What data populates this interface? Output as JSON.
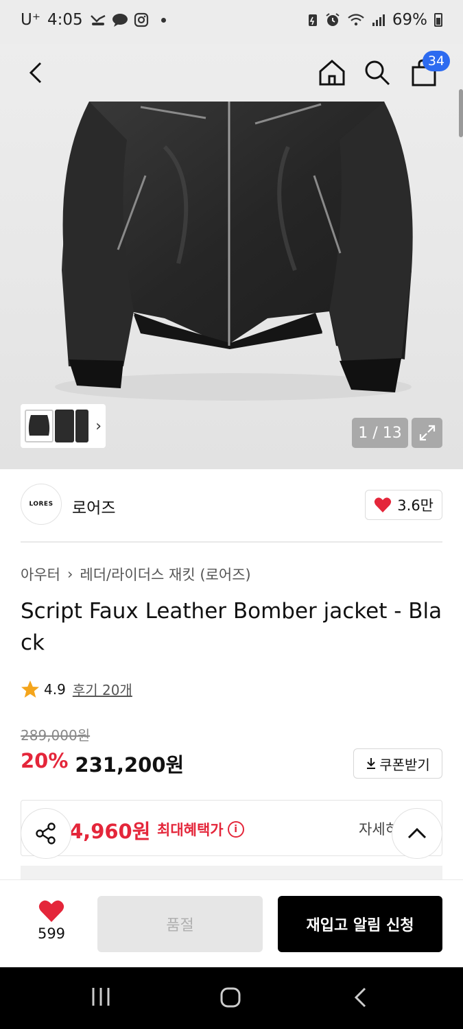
{
  "status_bar": {
    "carrier": "U⁺",
    "time": "4:05",
    "battery": "69%"
  },
  "header": {
    "cart_count": "34"
  },
  "gallery": {
    "counter": "1 / 13"
  },
  "brand": {
    "logo_text": "LORES",
    "name": "로어즈",
    "likes": "3.6만"
  },
  "breadcrumb": {
    "category": "아우터",
    "subcategory": "레더/라이더스 재킷 (로어즈)"
  },
  "product": {
    "title": "Script Faux Leather Bomber jacket - Black",
    "rating": "4.9",
    "reviews": "후기 20개",
    "original_price": "289,000원",
    "discount": "20%",
    "sale_price": "231,200원",
    "coupon_label": "쿠폰받기"
  },
  "benefit": {
    "price": "4,960원",
    "label": "최대혜택가",
    "detail": "자세히"
  },
  "bottom_bar": {
    "wish_count": "599",
    "soldout_label": "품절",
    "restock_label": "재입고 알림 신청"
  },
  "colors": {
    "accent_red": "#e4263a",
    "badge_blue": "#2d6bf0"
  }
}
